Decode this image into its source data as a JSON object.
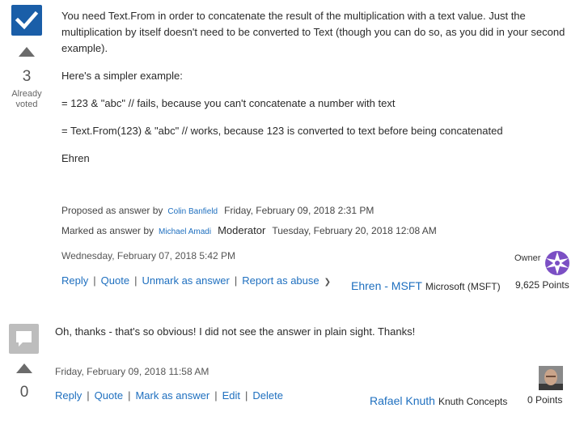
{
  "post1": {
    "votes": "3",
    "vote_note": "Already voted",
    "paragraphs": [
      "You need Text.From in order to concatenate the result of the multiplication with a text value. Just the multiplication by itself doesn't need to be converted to Text (though you can do so, as you did in your second example).",
      "Here's a simpler example:",
      "= 123 & \"abc\" // fails, because you can't concatenate a number with text",
      "= Text.From(123) & \"abc\" // works, because 123 is converted to text before being concatenated",
      "Ehren"
    ],
    "proposed": {
      "label": "Proposed as answer by",
      "user": "Colin Banfield",
      "date": "Friday, February 09, 2018 2:31 PM"
    },
    "marked": {
      "label": "Marked as answer by",
      "user": "Michael Amadi",
      "role": "Moderator",
      "date": "Tuesday, February 20, 2018 12:08 AM"
    },
    "timestamp": "Wednesday, February 07, 2018 5:42 PM",
    "actions": [
      "Reply",
      "Quote",
      "Unmark as answer",
      "Report as abuse"
    ],
    "author": {
      "name": "Ehren - MSFT",
      "org": "Microsoft (MSFT)",
      "owner_label": "Owner",
      "points": "9,625 Points"
    }
  },
  "post2": {
    "votes": "0",
    "paragraphs": [
      "Oh, thanks - that's so obvious! I did not see the answer in plain sight. Thanks!"
    ],
    "timestamp": "Friday, February 09, 2018 11:58 AM",
    "actions": [
      "Reply",
      "Quote",
      "Mark as answer",
      "Edit",
      "Delete"
    ],
    "author": {
      "name": "Rafael Knuth",
      "org": "Knuth Concepts",
      "points": "0 Points"
    }
  },
  "colors": {
    "link": "#1e6fbf",
    "answer_badge": "#1a5ea8",
    "comment_badge": "#bdbdbd",
    "avatar_purple": "#7b4fc4"
  },
  "icons": {
    "answered": "checkmark-icon",
    "vote_up": "triangle-up-icon",
    "comment": "speech-bubble-icon",
    "dropdown": "chevron-down-icon"
  }
}
